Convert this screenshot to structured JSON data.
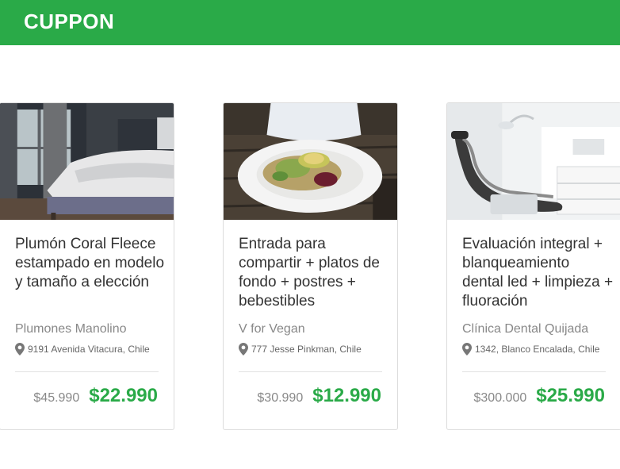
{
  "app": {
    "brand": "CUPPON"
  },
  "colors": {
    "brand_green": "#2aaa48",
    "price_green": "#2aaa48"
  },
  "cards": [
    {
      "image": "bedroom-duvet-photo",
      "title": "Plumón Coral Fleece estampado en modelo y tamaño a elección",
      "merchant": "Plumones Manolino",
      "location_icon": "map-pin-icon",
      "address": "9191 Avenida Vitacura, Chile",
      "old_price": "$45.990",
      "new_price": "$22.990"
    },
    {
      "image": "vegan-salad-plate-photo",
      "title": "Entrada para compartir + platos de fondo + postres + bebestibles",
      "merchant": "V for Vegan",
      "location_icon": "map-pin-icon",
      "address": "777 Jesse Pinkman, Chile",
      "old_price": "$30.990",
      "new_price": "$12.990"
    },
    {
      "image": "dental-chair-photo",
      "title": "Evaluación integral + blanqueamiento dental led + limpieza + fluoración",
      "merchant": "Clínica Dental Quijada",
      "location_icon": "map-pin-icon",
      "address": "1342, Blanco Encalada, Chile",
      "old_price": "$300.000",
      "new_price": "$25.990"
    }
  ]
}
